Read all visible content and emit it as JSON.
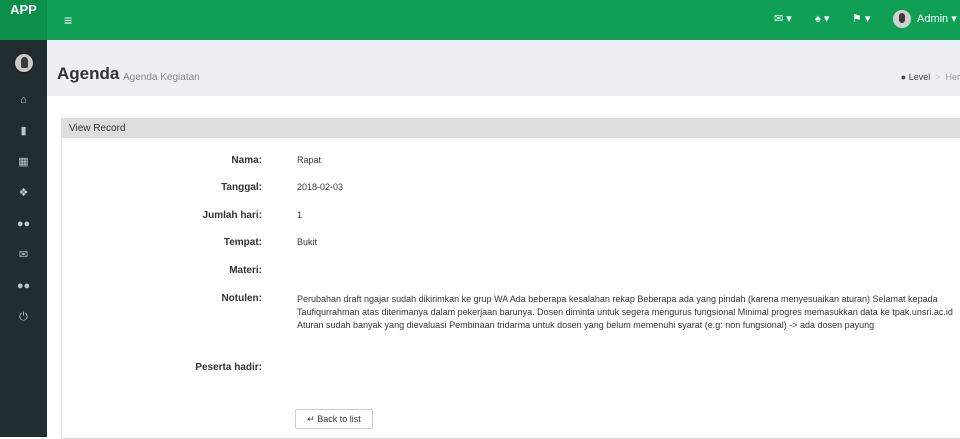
{
  "app": {
    "brand": "APP"
  },
  "sidebar": {
    "icons": [
      "avatar",
      "home-icon",
      "file-icon",
      "calendar-icon",
      "info-icon",
      "users-icon",
      "mail-icon",
      "users-icon",
      "power-icon"
    ]
  },
  "topbar": {
    "menu_icon": "hamburger-icon",
    "user_name": "Admin",
    "nav_icons": [
      "envelope-icon",
      "bell-icon",
      "flag-icon"
    ]
  },
  "header": {
    "title": "Agenda",
    "subtitle": "Agenda Kegiatan",
    "breadcrumb": [
      "Level",
      "Her"
    ]
  },
  "panel": {
    "heading": "View Record",
    "fields": [
      {
        "label": "Nama:",
        "value": "Rapat"
      },
      {
        "label": "Tanggal:",
        "value": "2018-02-03"
      },
      {
        "label": "Jumlah hari:",
        "value": "1"
      },
      {
        "label": "Tempat:",
        "value": "Bukit"
      },
      {
        "label": "Materi:",
        "value": ""
      },
      {
        "label": "Notulen:",
        "value": "Perubahan draft ngajar sudah dikirimkan ke grup WA Ada beberapa kesalahan rekap Beberapa ada yang pindah (karena menyesuaikan aturan) Selamat kepada Taufiqurrahman atas diterimanya dalam pekerjaan barunya. Dosen diminta untuk segera mengurus fungsional Minimal progres memasukkan data ke tpak.unsri.ac.id Aturan sudah banyak yang dievaluasi Pembinaan tridarma untuk dosen yang belum memenuhi syarat (e.g: non fungsional) -> ada dosen payung"
      },
      {
        "label": "Peserta hadir:",
        "value": ""
      }
    ],
    "back_label": "Back to list"
  },
  "colors": {
    "topbar": "#10a055",
    "brand": "#0d8f4c",
    "sidebar": "#222d32"
  }
}
